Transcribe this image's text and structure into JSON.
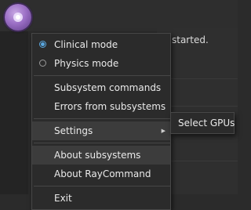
{
  "app": {
    "status_text": "started."
  },
  "menu": {
    "items": [
      {
        "label": "Clinical mode",
        "type": "radio",
        "checked": true
      },
      {
        "label": "Physics mode",
        "type": "radio",
        "checked": false
      },
      {
        "label": "Subsystem commands"
      },
      {
        "label": "Errors from subsystems"
      },
      {
        "label": "Settings",
        "has_submenu": true,
        "highlighted": true
      },
      {
        "label": "About subsystems",
        "highlighted": true
      },
      {
        "label": "About RayCommand"
      },
      {
        "label": "Exit"
      }
    ],
    "submenu_arrow": "▶"
  },
  "submenu": {
    "items": [
      {
        "label": "Select GPUs"
      }
    ]
  },
  "colors": {
    "accent": "#59a7e0",
    "menu_bg": "#2b2b2b",
    "menu_border": "#474747",
    "highlight": "#3c3c3c",
    "app_button": "#9b6fc5"
  }
}
